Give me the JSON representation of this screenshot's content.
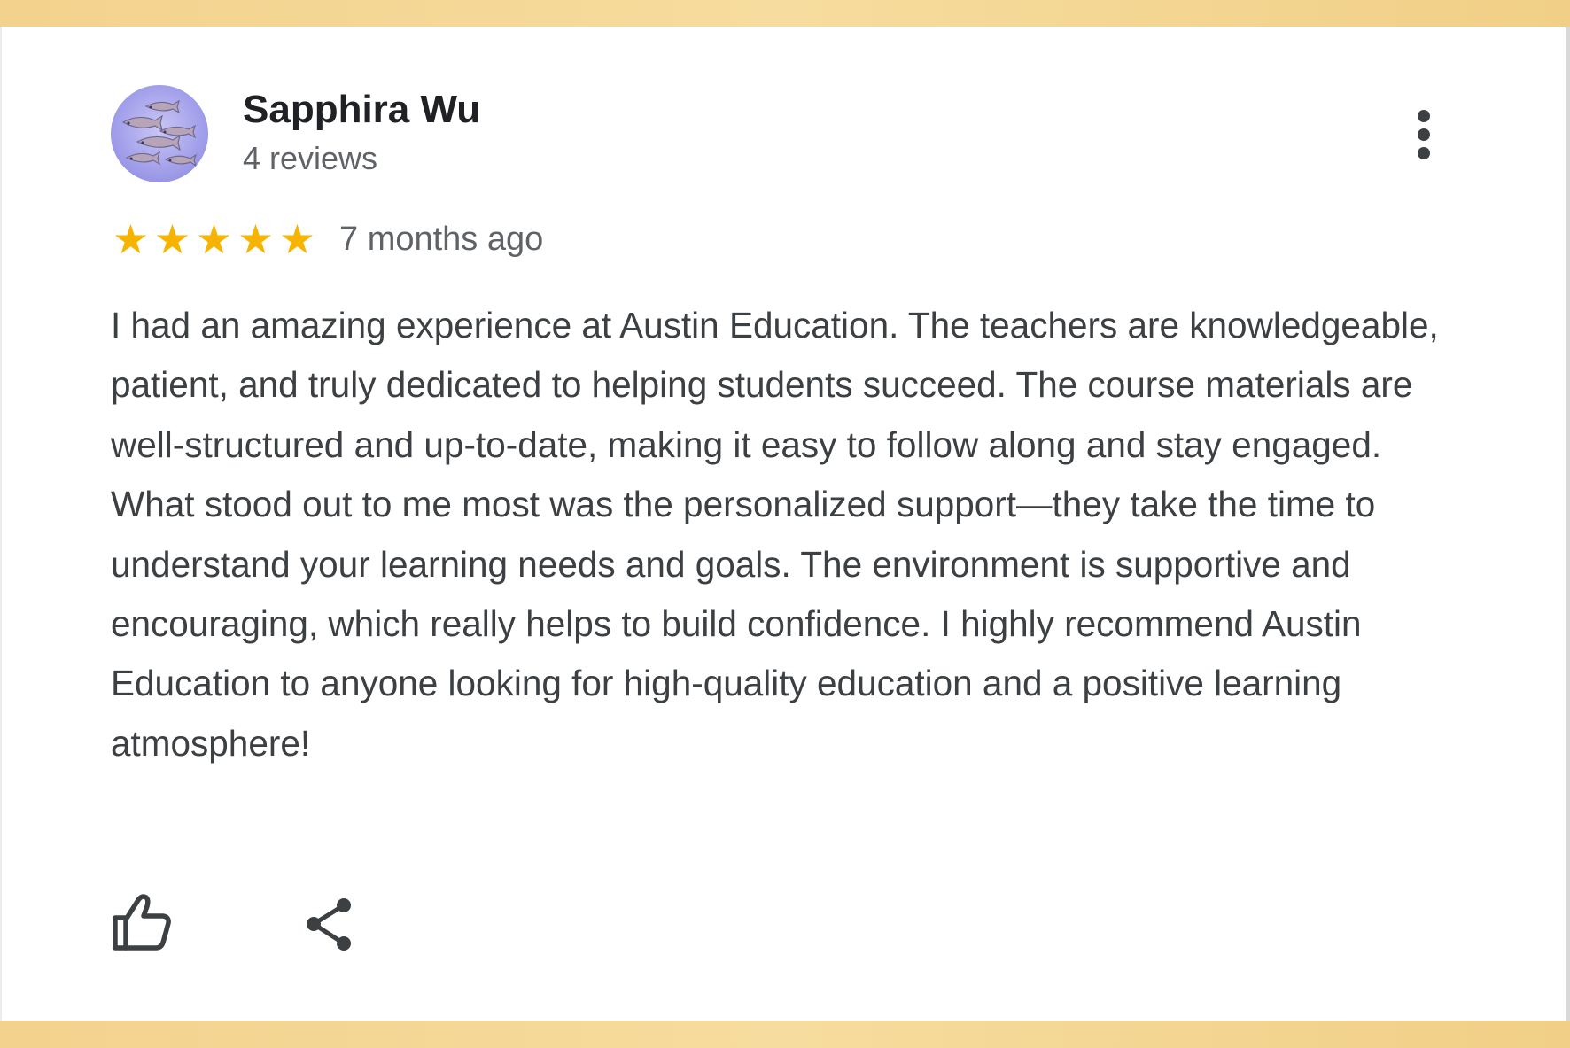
{
  "reviewer": {
    "name": "Sapphira Wu",
    "review_count": "4 reviews",
    "avatar_icon": "fish-school-avatar"
  },
  "menu": {
    "icon": "more-vertical-icon"
  },
  "rating": {
    "stars": 5,
    "max_stars": 5,
    "star_color": "#f6b400",
    "time_ago": "7 months ago"
  },
  "review": {
    "text": "I had an amazing experience at Austin Education. The teachers are knowledgeable, patient, and truly dedicated to helping students succeed. The course materials are well-structured and up-to-date, making it easy to follow along and stay engaged. What stood out to me most was the personalized support—they take the time to understand your learning needs and goals. The environment is supportive and encouraging, which really helps to build confidence. I highly recommend Austin Education to anyone looking for high-quality education and a positive learning atmosphere!"
  },
  "actions": {
    "like_icon": "thumbs-up-icon",
    "share_icon": "share-icon"
  },
  "theme": {
    "band_color": "#f3d28d",
    "text_color": "#3c4043",
    "name_color": "#202124",
    "muted_color": "#5f6368"
  }
}
